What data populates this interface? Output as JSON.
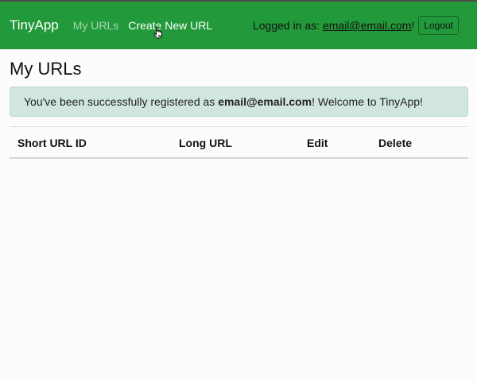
{
  "navbar": {
    "brand": "TinyApp",
    "links": [
      {
        "label": "My URLs"
      },
      {
        "label": "Create New URL"
      }
    ],
    "logged_in_prefix": "Logged in as: ",
    "user_email": "email@email.com",
    "logged_in_suffix": "!",
    "logout_label": "Logout",
    "color": "#229a3b"
  },
  "main": {
    "title": "My URLs",
    "alert": {
      "prefix": "You've been successfully registered as ",
      "email": "email@email.com",
      "suffix": "! Welcome to TinyApp!",
      "color": "#d1e7dd"
    },
    "table": {
      "columns": [
        "Short URL ID",
        "Long URL",
        "Edit",
        "Delete"
      ],
      "rows": []
    }
  },
  "cursor": {
    "icon": "hand-pointer-icon"
  }
}
